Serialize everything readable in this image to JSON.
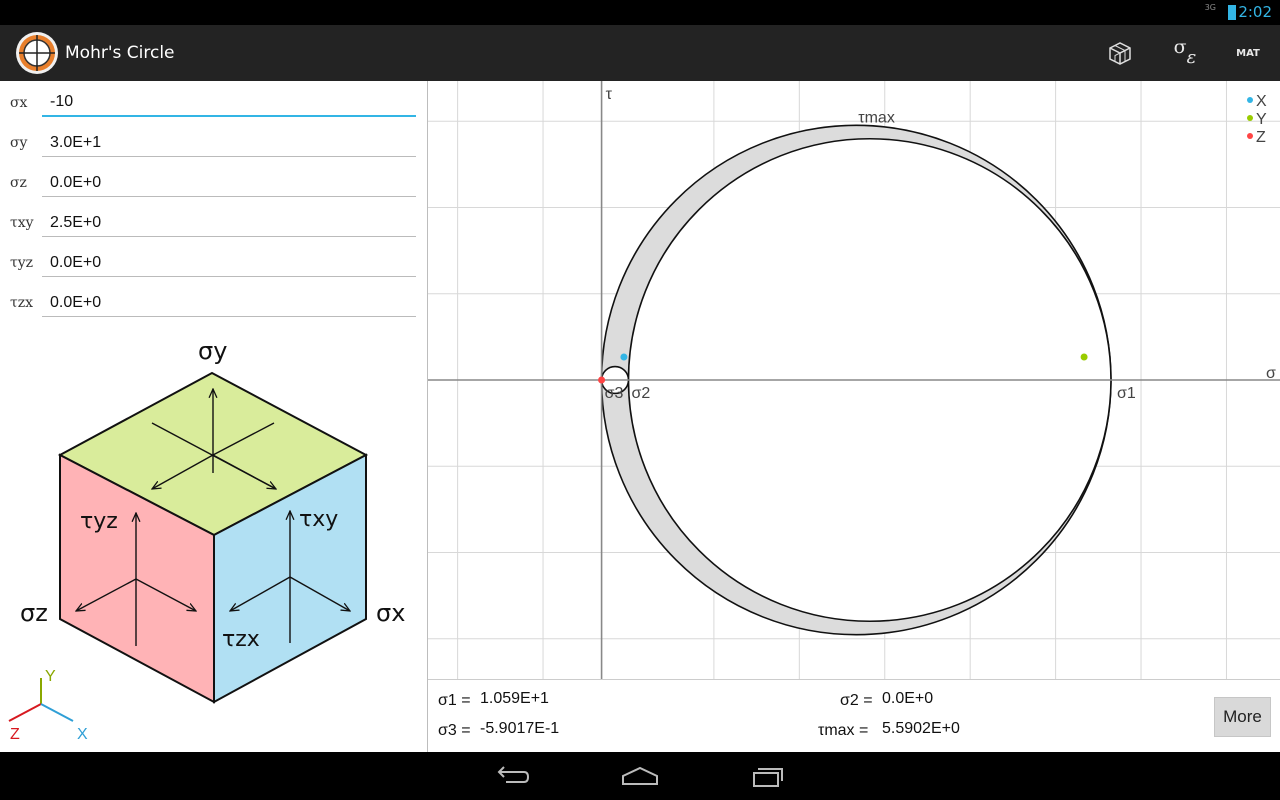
{
  "status_bar": {
    "network": "3G",
    "time": "2:02"
  },
  "app": {
    "title": "Mohr's Circle"
  },
  "action_bar": {
    "sigma_label": "σ",
    "epsilon_label": "ε",
    "mat_label": "MAT"
  },
  "inputs": [
    {
      "label": "σx",
      "value": "-10"
    },
    {
      "label": "σy",
      "value": "3.0E+1"
    },
    {
      "label": "σz",
      "value": "0.0E+0"
    },
    {
      "label": "τxy",
      "value": "2.5E+0"
    },
    {
      "label": "τyz",
      "value": "0.0E+0"
    },
    {
      "label": "τzx",
      "value": "0.0E+0"
    }
  ],
  "cube": {
    "sigma_y": "σy",
    "sigma_z": "σz",
    "sigma_x": "σx",
    "tau_yz": "τyz",
    "tau_xy": "τxy",
    "tau_zx": "τzx",
    "face_colors": {
      "top": "#d9ec9b",
      "left": "#ffb3b6",
      "right": "#b1e0f3"
    }
  },
  "axes_triad": {
    "y": "Y",
    "z": "Z",
    "x": "X",
    "colors": {
      "y": "#8aa800",
      "z": "#d71920",
      "x": "#2f9fd6"
    }
  },
  "plot": {
    "tau_axis": "τ",
    "sigma_axis": "σ",
    "tau_max_label": "τmax",
    "sigma1_label": "σ1",
    "sigma2_label": "σ2",
    "sigma3_label": "σ3",
    "legend": [
      {
        "name": "X",
        "color": "#33b5e5"
      },
      {
        "name": "Y",
        "color": "#99cc00"
      },
      {
        "name": "Z",
        "color": "#ff4444"
      }
    ],
    "shade_color": "#dcdcdc"
  },
  "chart_data": {
    "type": "scatter",
    "principal_stresses": {
      "sigma1": 10.59,
      "sigma2": 0.0,
      "sigma3": -0.59017
    },
    "tau_max": 5.5902,
    "points": [
      {
        "name": "X",
        "sigma": -0.1,
        "tau": 0.5
      },
      {
        "name": "Y",
        "sigma": 10.0,
        "tau": 0.5
      },
      {
        "name": "Z",
        "sigma": -0.59017,
        "tau": 0.0
      }
    ],
    "xlim": [
      -4.4,
      14.3
    ],
    "ylim": [
      -6.5,
      6.5
    ],
    "grid": true,
    "legend": "top-right"
  },
  "results": {
    "sigma1_label": "σ1 =",
    "sigma1_value": "1.059E+1",
    "sigma2_label": "σ2 =",
    "sigma2_value": "0.0E+0",
    "sigma3_label": "σ3 =",
    "sigma3_value": "-5.9017E-1",
    "taumax_label": "τmax =",
    "taumax_value": "5.5902E+0",
    "more_button": "More"
  }
}
